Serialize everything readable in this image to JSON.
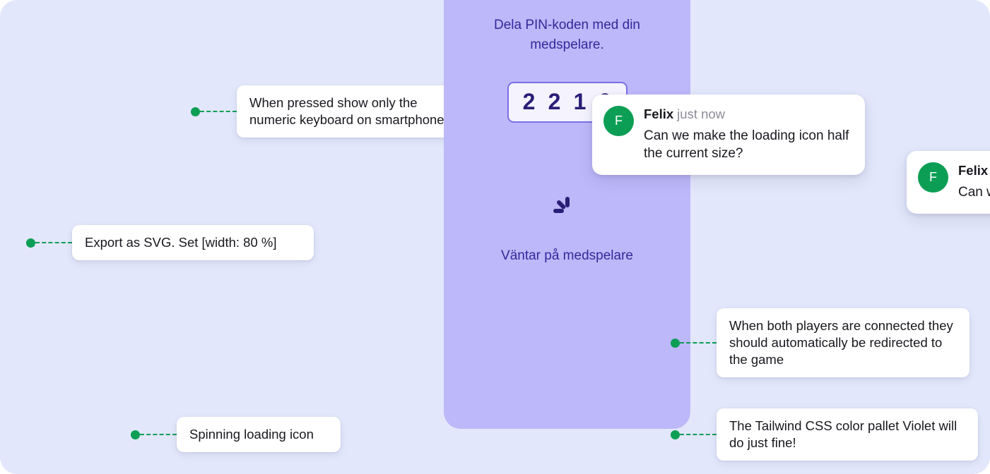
{
  "canvas": {
    "background_color": "#E2E7FB",
    "corner_radius_px": 24
  },
  "prototype_panel": {
    "background_color": "#BDB8F9",
    "title": "Dela PIN-kod",
    "subtitle": "Dela PIN-koden med din medspelare.",
    "pin_code": {
      "digits": [
        "2",
        "2",
        "1",
        "9"
      ],
      "border_color": "#7B6FE8",
      "field_background": "#F4F3FE"
    },
    "loading_icon": {
      "name": "spinning-loader-icon",
      "dash_count": 3,
      "color": "#2A1E77"
    },
    "status_text": "Väntar på medspelare"
  },
  "annotations": [
    {
      "id": "keyboard",
      "text": "When pressed show only the numeric keyboard on smartphones",
      "marker_color": "#0C9E55"
    },
    {
      "id": "svg",
      "text": "Export as SVG. Set [width: 80 %]",
      "marker_color": "#0C9E55"
    },
    {
      "id": "spinner",
      "text": "Spinning loading icon",
      "marker_color": "#0C9E55"
    },
    {
      "id": "redirect",
      "text": "When both players are connected they should automatically be redirected to the game",
      "marker_color": "#0C9E55"
    },
    {
      "id": "violet",
      "text": "The Tailwind CSS color pallet Violet will do just fine!",
      "marker_color": "#0C9E55"
    }
  ],
  "comments": [
    {
      "id": "main",
      "avatar_initial": "F",
      "avatar_color": "#0C9E55",
      "author": "Felix",
      "timestamp": "just now",
      "text": "Can we make the loading icon half the current size?"
    },
    {
      "id": "partial",
      "avatar_initial": "F",
      "avatar_color": "#0C9E55",
      "author": "Felix",
      "timestamp": "",
      "text": "Can we make the loading icon half the current size?"
    }
  ]
}
